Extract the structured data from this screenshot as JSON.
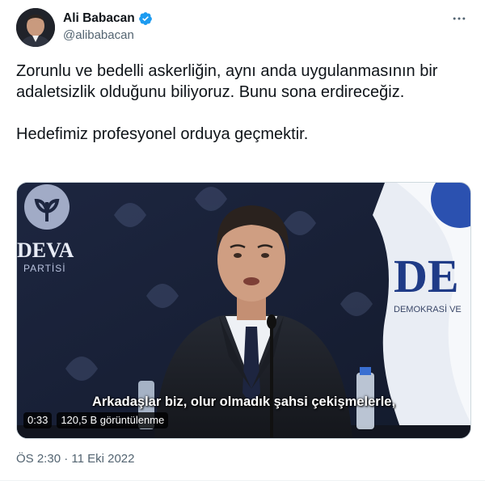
{
  "author": {
    "display_name": "Ali Babacan",
    "handle": "@alibabacan",
    "verified": true
  },
  "tweet": {
    "text": "Zorunlu ve bedelli askerliğin, aynı anda uygulanmasının bir adaletsizlik olduğunu biliyoruz. Bunu sona erdireceğiz.\n\nHedefimiz profesyonel orduya geçmektir."
  },
  "video": {
    "subtitle": "Arkadaşlar biz, olur olmadık şahsi çekişmelerle,",
    "duration": "0:33",
    "views": "120,5 B görüntülenme",
    "backdrop_logo_text": "DEVA",
    "backdrop_logo_subtext": "PARTİSİ",
    "banner_text": "DE",
    "banner_subtext": "DEMOKRASİ VE"
  },
  "meta": {
    "timestamp": "ÖS 2:30 · 11 Eki 2022"
  },
  "colors": {
    "text_primary": "#0f1419",
    "text_secondary": "#536471",
    "verified_blue": "#1d9bf0",
    "border": "#cfd9de",
    "backdrop_navy": "#1a2238"
  },
  "icons": {
    "verified": "verified-badge-icon",
    "more": "more-horizontal-icon"
  }
}
